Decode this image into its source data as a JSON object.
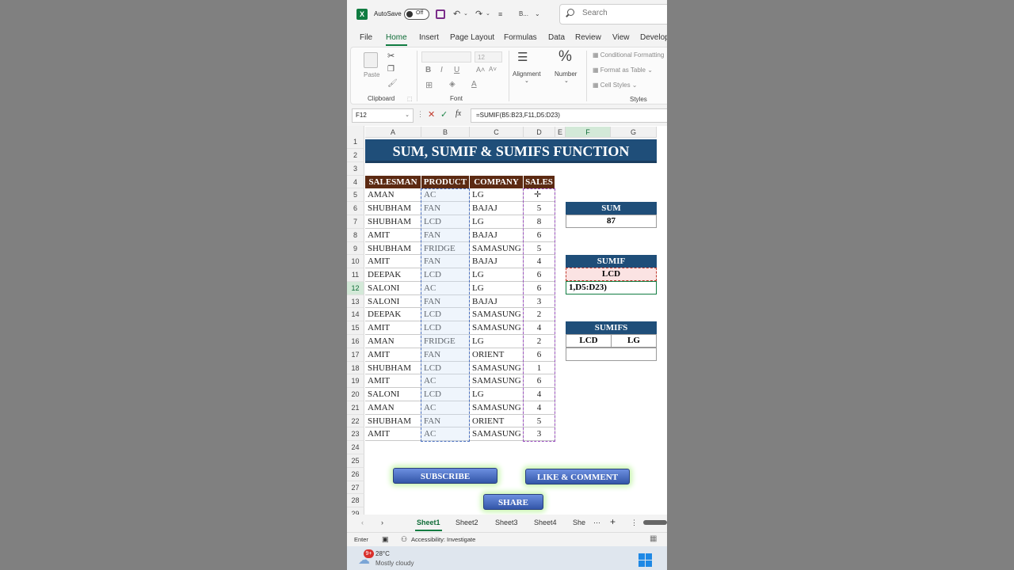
{
  "titlebar": {
    "autosave_label": "AutoSave",
    "toggle_state": "Off",
    "file_name": "B...",
    "search_placeholder": "Search"
  },
  "ribbon_tabs": [
    "File",
    "Home",
    "Insert",
    "Page Layout",
    "Formulas",
    "Data",
    "Review",
    "View",
    "Develop"
  ],
  "active_tab": "Home",
  "ribbon": {
    "clipboard": {
      "paste": "Paste",
      "label": "Clipboard"
    },
    "font": {
      "font_name": "",
      "font_size": "12",
      "bold": "B",
      "italic": "I",
      "underline": "U",
      "label": "Font"
    },
    "alignment": {
      "label": "Alignment"
    },
    "number": {
      "symbol": "%",
      "label": "Number"
    },
    "styles": {
      "conditional": "Conditional Formatting",
      "format_table": "Format as Table",
      "cell_styles": "Cell Styles",
      "label": "Styles"
    }
  },
  "formula_bar": {
    "name_box": "F12",
    "formula": "=SUMIF(B5:B23,F11,D5:D23)"
  },
  "columns": [
    "A",
    "B",
    "C",
    "D",
    "E",
    "F",
    "G"
  ],
  "rows": [
    "1",
    "2",
    "3",
    "4",
    "5",
    "6",
    "7",
    "8",
    "9",
    "10",
    "11",
    "12",
    "13",
    "14",
    "15",
    "16",
    "17",
    "18",
    "19",
    "20",
    "21",
    "22",
    "23",
    "24",
    "25",
    "26",
    "27",
    "28",
    "29"
  ],
  "sheet_title": "SUM, SUMIF & SUMIFS FUNCTION",
  "table": {
    "headers": [
      "SALESMAN",
      "PRODUCT",
      "COMPANY",
      "SALES"
    ],
    "rows": [
      [
        "AMAN",
        "AC",
        "LG",
        ""
      ],
      [
        "SHUBHAM",
        "FAN",
        "BAJAJ",
        "5"
      ],
      [
        "SHUBHAM",
        "LCD",
        "LG",
        "8"
      ],
      [
        "AMIT",
        "FAN",
        "BAJAJ",
        "6"
      ],
      [
        "SHUBHAM",
        "FRIDGE",
        "SAMASUNG",
        "5"
      ],
      [
        "AMIT",
        "FAN",
        "BAJAJ",
        "4"
      ],
      [
        "DEEPAK",
        "LCD",
        "LG",
        "6"
      ],
      [
        "SALONI",
        "AC",
        "LG",
        "6"
      ],
      [
        "SALONI",
        "FAN",
        "BAJAJ",
        "3"
      ],
      [
        "DEEPAK",
        "LCD",
        "SAMASUNG",
        "2"
      ],
      [
        "AMIT",
        "LCD",
        "SAMASUNG",
        "4"
      ],
      [
        "AMAN",
        "FRIDGE",
        "LG",
        "2"
      ],
      [
        "AMIT",
        "FAN",
        "ORIENT",
        "6"
      ],
      [
        "SHUBHAM",
        "LCD",
        "SAMASUNG",
        "1"
      ],
      [
        "AMIT",
        "AC",
        "SAMASUNG",
        "6"
      ],
      [
        "SALONI",
        "LCD",
        "LG",
        "4"
      ],
      [
        "AMAN",
        "AC",
        "SAMASUNG",
        "4"
      ],
      [
        "SHUBHAM",
        "FAN",
        "ORIENT",
        "5"
      ],
      [
        "AMIT",
        "AC",
        "SAMASUNG",
        "3"
      ]
    ]
  },
  "sum_box": {
    "label": "SUM",
    "value": "87"
  },
  "sumif_box": {
    "label": "SUMIF",
    "criteria": "LCD",
    "editing": "1,D5:D23)"
  },
  "sumifs_box": {
    "label": "SUMIFS",
    "criteria1": "LCD",
    "criteria2": "LG"
  },
  "overlay_buttons": {
    "subscribe": "SUBSCRIBE",
    "like": "LIKE & COMMENT",
    "share": "SHARE"
  },
  "sheet_tabs": [
    "Sheet1",
    "Sheet2",
    "Sheet3",
    "Sheet4",
    "She"
  ],
  "statusbar": {
    "mode": "Enter",
    "accessibility": "Accessibility: Investigate"
  },
  "taskbar": {
    "temp": "28°C",
    "weather": "Mostly cloudy",
    "badge": "9+"
  }
}
